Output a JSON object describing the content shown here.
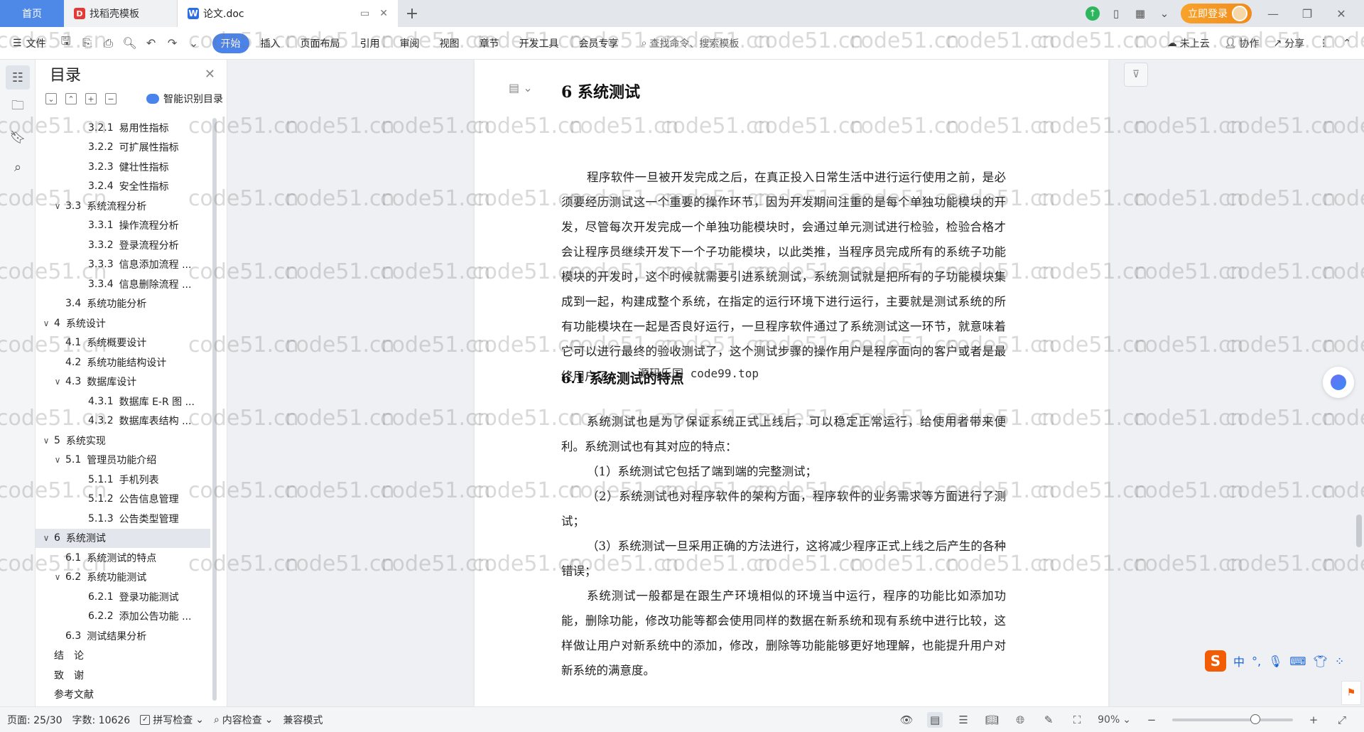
{
  "titlebar": {
    "tabs": [
      {
        "label": "首页"
      },
      {
        "label": "找稻壳模板"
      },
      {
        "label": "论文.doc"
      }
    ],
    "login_label": "立即登录"
  },
  "menubar": {
    "file_label": "文件",
    "tabs": [
      "开始",
      "插入",
      "页面布局",
      "引用",
      "审阅",
      "视图",
      "章节",
      "开发工具",
      "会员专享"
    ],
    "active_tab": "开始",
    "search_label": "查找命令、搜索模板",
    "right": {
      "cloud": "未上云",
      "collab": "协作",
      "share": "分享"
    }
  },
  "toc": {
    "title": "目录",
    "smart_label": "智能识别目录",
    "items": [
      {
        "num": "3.2.1",
        "text": "易用性指标",
        "level": 3,
        "caret": ""
      },
      {
        "num": "3.2.2",
        "text": "可扩展性指标",
        "level": 3,
        "caret": ""
      },
      {
        "num": "3.2.3",
        "text": "健壮性指标",
        "level": 3,
        "caret": ""
      },
      {
        "num": "3.2.4",
        "text": "安全性指标",
        "level": 3,
        "caret": ""
      },
      {
        "num": "3.3",
        "text": "系统流程分析",
        "level": 2,
        "caret": "∨"
      },
      {
        "num": "3.3.1",
        "text": "操作流程分析",
        "level": 3,
        "caret": ""
      },
      {
        "num": "3.3.2",
        "text": "登录流程分析",
        "level": 3,
        "caret": ""
      },
      {
        "num": "3.3.3",
        "text": "信息添加流程 ...",
        "level": 3,
        "caret": ""
      },
      {
        "num": "3.3.4",
        "text": "信息删除流程 ...",
        "level": 3,
        "caret": ""
      },
      {
        "num": "3.4",
        "text": "系统功能分析",
        "level": 2,
        "caret": ""
      },
      {
        "num": "4",
        "text": "系统设计",
        "level": 1,
        "caret": "∨"
      },
      {
        "num": "4.1",
        "text": "系统概要设计",
        "level": 2,
        "caret": ""
      },
      {
        "num": "4.2",
        "text": "系统功能结构设计",
        "level": 2,
        "caret": ""
      },
      {
        "num": "4.3",
        "text": "数据库设计",
        "level": 2,
        "caret": "∨"
      },
      {
        "num": "4.3.1",
        "text": "数据库 E-R 图 ...",
        "level": 3,
        "caret": ""
      },
      {
        "num": "4.3.2",
        "text": "数据库表结构 ...",
        "level": 3,
        "caret": ""
      },
      {
        "num": "5",
        "text": "系统实现",
        "level": 1,
        "caret": "∨"
      },
      {
        "num": "5.1",
        "text": "管理员功能介绍",
        "level": 2,
        "caret": "∨"
      },
      {
        "num": "5.1.1",
        "text": "手机列表",
        "level": 3,
        "caret": ""
      },
      {
        "num": "5.1.2",
        "text": "公告信息管理",
        "level": 3,
        "caret": ""
      },
      {
        "num": "5.1.3",
        "text": "公告类型管理",
        "level": 3,
        "caret": ""
      },
      {
        "num": "6",
        "text": "系统测试",
        "level": 1,
        "caret": "∨",
        "selected": true
      },
      {
        "num": "6.1",
        "text": "系统测试的特点",
        "level": 2,
        "caret": ""
      },
      {
        "num": "6.2",
        "text": "系统功能测试",
        "level": 2,
        "caret": "∨"
      },
      {
        "num": "6.2.1",
        "text": "登录功能测试",
        "level": 3,
        "caret": ""
      },
      {
        "num": "6.2.2",
        "text": "添加公告功能 ...",
        "level": 3,
        "caret": ""
      },
      {
        "num": "6.3",
        "text": "测试结果分析",
        "level": 2,
        "caret": ""
      },
      {
        "num": "",
        "text": "结　论",
        "level": 1,
        "caret": ""
      },
      {
        "num": "",
        "text": "致　谢",
        "level": 1,
        "caret": ""
      },
      {
        "num": "",
        "text": "参考文献",
        "level": 1,
        "caret": ""
      }
    ]
  },
  "document": {
    "heading1": "6  系统测试",
    "para1": "程序软件一旦被开发完成之后，在真正投入日常生活中进行运行使用之前，是必须要经历测试这一个重要的操作环节，因为开发期间注重的是每个单独功能模块的开发，尽管每次开发完成一个单独功能模块时，会通过单元测试进行检验，检验合格才会让程序员继续开发下一个子功能模块，以此类推，当程序员完成所有的系统子功能模块的开发时，这个时候就需要引进系统测试，系统测试就是把所有的子功能模块集成到一起，构建成整个系统，在指定的运行环境下进行运行，主要就是测试系统的所有功能模块在一起是否良好运行，一旦程序软件通过了系统测试这一环节，就意味着它可以进行最终的验收测试了，这个测试步骤的操作用户是程序面向的客户或者是最终用户了。",
    "heading2": "6.1  系统测试的特点",
    "overlay": "源码乐园 code99.top",
    "para2": "系统测试也是为了保证系统正式上线后，可以稳定正常运行，给使用者带来便利。系统测试也有其对应的特点：",
    "bullet1": "（1）系统测试它包括了端到端的完整测试；",
    "bullet2": "（2）系统测试也对程序软件的架构方面，程序软件的业务需求等方面进行了测试；",
    "bullet3": "（3）系统测试一旦采用正确的方法进行，这将减少程序正式上线之后产生的各种错误；",
    "para3": "系统测试一般都是在跟生产环境相似的环境当中运行，程序的功能比如添加功能，删除功能，修改功能等都会使用同样的数据在新系统和现有系统中进行比较，这样做让用户对新系统中的添加，修改，删除等功能能够更好地理解，也能提升用户对新系统的满意度。"
  },
  "ime": {
    "lang": "中"
  },
  "watermark": "code51.cn",
  "statusbar": {
    "page": "页面: 25/30",
    "words": "字数: 10626",
    "spell": "拼写检查",
    "content_check": "内容检查",
    "compat": "兼容模式",
    "zoom": "90%",
    "zoom_fraction": 0.69
  },
  "colors": {
    "accent": "#4b83ec",
    "home_tab": "#4f89e8",
    "login": "#f39a22"
  }
}
